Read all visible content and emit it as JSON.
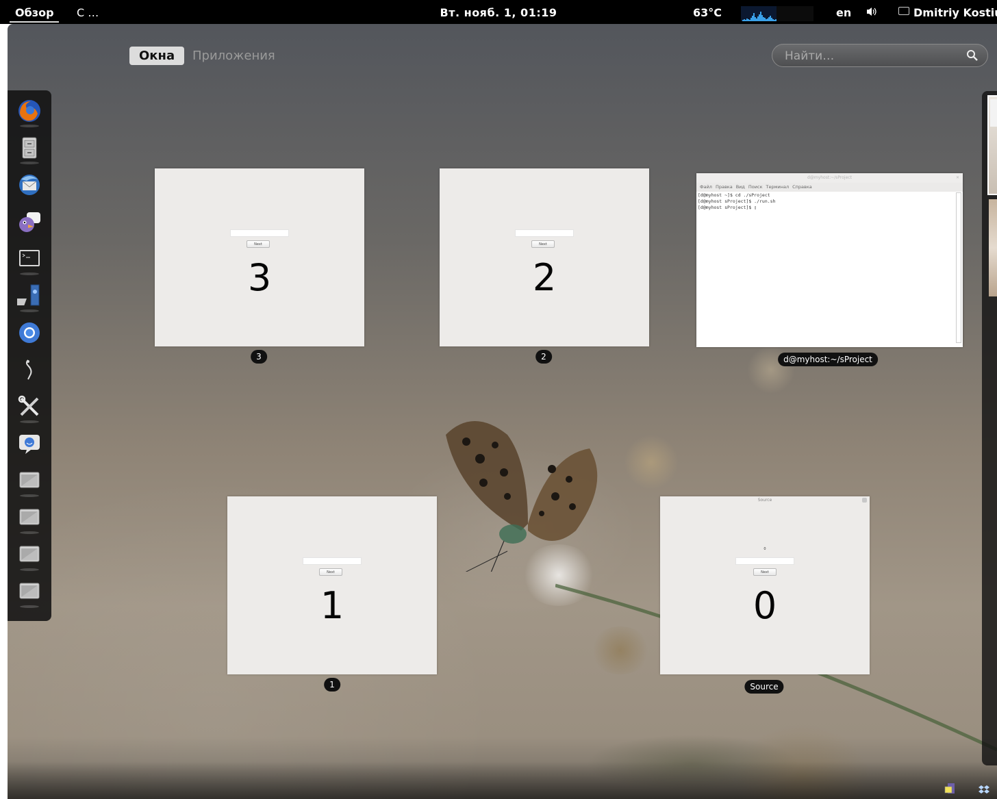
{
  "panel": {
    "activities": "Обзор",
    "app_menu": "С …",
    "clock": "Вт. нояб.  1, 01:19",
    "temperature": "63°C",
    "language": "en",
    "user": "Dmitriy Kostiuk"
  },
  "overview": {
    "windows_tab": "Окна",
    "applications_tab": "Приложения",
    "search_placeholder": "Найти…"
  },
  "dash": {
    "items": [
      {
        "icon": "firefox-icon"
      },
      {
        "icon": "file-cabinet-icon"
      },
      {
        "icon": "thunderbird-icon"
      },
      {
        "icon": "pidgin-icon"
      },
      {
        "icon": "terminal-icon"
      },
      {
        "icon": "system-monitor-icon"
      },
      {
        "icon": "chromium-icon"
      },
      {
        "icon": "inkscape-pen-icon"
      },
      {
        "icon": "tools-icon"
      },
      {
        "icon": "chat-icon"
      },
      {
        "icon": "window-icon"
      },
      {
        "icon": "window-icon"
      },
      {
        "icon": "window-icon"
      },
      {
        "icon": "window-icon"
      }
    ]
  },
  "windows": {
    "w3": {
      "caption": "3",
      "number": "3",
      "button": "Next"
    },
    "w2": {
      "caption": "2",
      "number": "2",
      "button": "Next"
    },
    "w1": {
      "caption": "1",
      "number": "1",
      "button": "Next"
    },
    "source": {
      "caption": "Source",
      "title": "Source",
      "label": "0",
      "number": "0",
      "button": "Next"
    },
    "terminal": {
      "caption": "d@myhost:~/sProject",
      "title": "d@myhost:~/sProject",
      "menu": [
        "Файл",
        "Правка",
        "Вид",
        "Поиск",
        "Терминал",
        "Справка"
      ],
      "lines": "[d@myhost ~]$ cd ./sProject\n[d@myhost sProject]$ ./run.sh\n[d@myhost sProject]$ ▯"
    }
  },
  "colors": {
    "panel_bg": "#000000",
    "dash_bg": "#121212",
    "window_bg": "#edebe9",
    "caption_bg": "#111111",
    "sysmon_cpu": "#3aa0e8"
  }
}
